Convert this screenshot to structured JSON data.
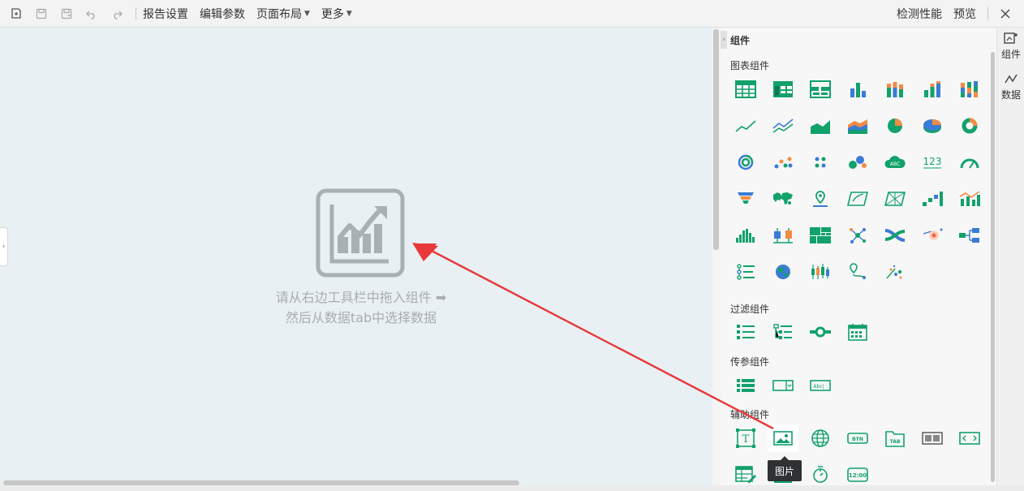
{
  "toolbar": {
    "menus": [
      {
        "label": "报告设置"
      },
      {
        "label": "编辑参数"
      },
      {
        "label": "页面布局"
      },
      {
        "label": "更多"
      }
    ],
    "right": {
      "check": "检测性能",
      "preview": "预览"
    }
  },
  "canvas": {
    "hint_line1": "请从右边工具栏中拖入组件",
    "hint_line2": "然后从数据tab中选择数据"
  },
  "panel": {
    "title": "组件",
    "sections": {
      "chart": "图表组件",
      "filter": "过滤组件",
      "param": "传参组件",
      "aux": "辅助组件"
    },
    "tooltip": "图片",
    "number_icon_text": "123",
    "abc_text": "ABC",
    "btn_text": "BTN",
    "tab_text": "TAB",
    "abcl_text": "Abc|",
    "time_text": "12:00",
    "text_icon_text": "T"
  },
  "rail": {
    "components": "组件",
    "data": "数据"
  },
  "colors": {
    "accent": "#12a16b",
    "annotation": "#e8393a"
  }
}
